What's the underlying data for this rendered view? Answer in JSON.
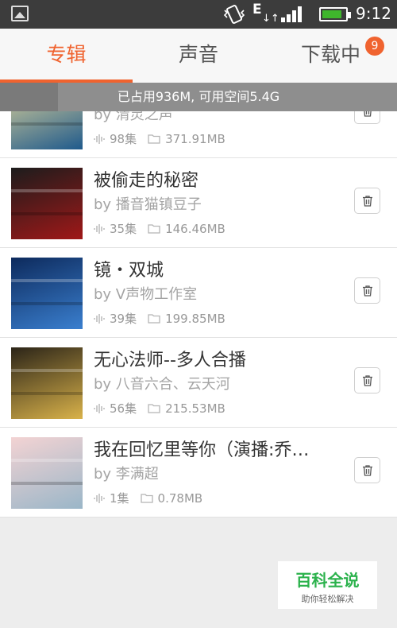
{
  "status_bar": {
    "network": "E",
    "network_arrows": "↓↑",
    "time": "9:12",
    "battery_level": 0.85,
    "icons": [
      "gallery-icon",
      "vibrate-icon",
      "signal-icon",
      "battery-icon"
    ]
  },
  "tabs": [
    {
      "label": "专辑",
      "active": true
    },
    {
      "label": "声音",
      "active": false
    },
    {
      "label": "下载中",
      "active": false,
      "badge": "9"
    }
  ],
  "storage": {
    "text": "已占用936M, 可用空间5.4G",
    "used_fraction": 0.145
  },
  "albums": [
    {
      "title": "",
      "author": "by 清灵之声",
      "episodes": "98集",
      "size": "371.91MB",
      "cover_colors": [
        "#e9d99a",
        "#1f5a8c"
      ]
    },
    {
      "title": "被偷走的秘密",
      "author": "by 播音猫镇豆子",
      "episodes": "35集",
      "size": "146.46MB",
      "cover_colors": [
        "#1c1c1c",
        "#a01818"
      ]
    },
    {
      "title": "镜・双城",
      "author": "by V声物工作室",
      "episodes": "39集",
      "size": "199.85MB",
      "cover_colors": [
        "#0d2a5c",
        "#3a7fcf"
      ]
    },
    {
      "title": "无心法师--多人合播",
      "author": "by 八音六合、云天河",
      "episodes": "56集",
      "size": "215.53MB",
      "cover_colors": [
        "#2b2418",
        "#d9b24a"
      ]
    },
    {
      "title": "我在回忆里等你（演播:乔…",
      "author": "by 李满超",
      "episodes": "1集",
      "size": "0.78MB",
      "cover_colors": [
        "#f3d3d3",
        "#9ab6c8"
      ]
    }
  ],
  "watermark": {
    "title": "百科全说",
    "subtitle": "助你轻松解决"
  },
  "colors": {
    "accent": "#f0632f",
    "statusbar": "#3c3c3c",
    "storage_bar": "#8e8e8e"
  }
}
